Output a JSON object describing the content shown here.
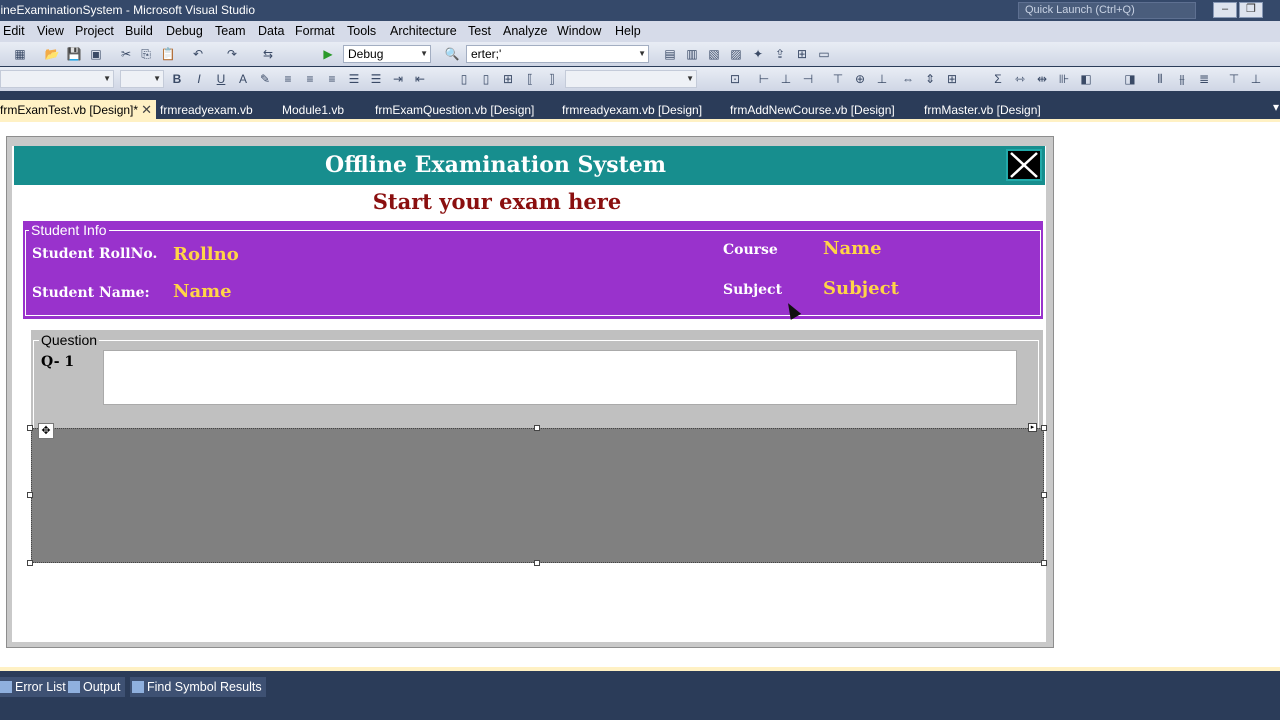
{
  "window": {
    "title": "OfflineExaminationSystem - Microsoft Visual Studio",
    "quick_launch_placeholder": "Quick Launch (Ctrl+Q)",
    "minimize": "‒",
    "restore": "❐"
  },
  "menu": [
    "Edit",
    "View",
    "Project",
    "Build",
    "Debug",
    "Team",
    "Data",
    "Format",
    "Tools",
    "Architecture",
    "Test",
    "Analyze",
    "Window",
    "Help"
  ],
  "toolbar": {
    "config": "Debug",
    "find_value": "erter;'",
    "bold": "B",
    "italic": "I",
    "underline": "U"
  },
  "tabs": [
    {
      "label": "frmExamTest.vb [Design]*",
      "active": true
    },
    {
      "label": "frmreadyexam.vb"
    },
    {
      "label": "Module1.vb"
    },
    {
      "label": "frmExamQuestion.vb [Design]"
    },
    {
      "label": "frmreadyexam.vb [Design]"
    },
    {
      "label": "frmAddNewCourse.vb [Design]"
    },
    {
      "label": "frmMaster.vb [Design]"
    }
  ],
  "form": {
    "header_title": "Offline Examination System",
    "subtitle": "Start your exam here",
    "student_info": {
      "caption": "Student Info",
      "rollno_label": "Student RollNo.",
      "rollno_value": "Rollno",
      "name_label": "Student Name:",
      "name_value": "Name",
      "course_label": "Course",
      "course_value": "Name",
      "subject_label": "Subject",
      "subject_value": "Subject"
    },
    "question": {
      "caption": "Question",
      "number": "Q- 1"
    }
  },
  "bottom_tabs": [
    "Error List",
    "Output",
    "Find Symbol Results"
  ],
  "colors": {
    "header": "#178e8e",
    "info_panel": "#9932cc",
    "value_text": "#ffd447",
    "subtitle": "#8a0f0f",
    "ide_dark": "#2b3c59"
  }
}
